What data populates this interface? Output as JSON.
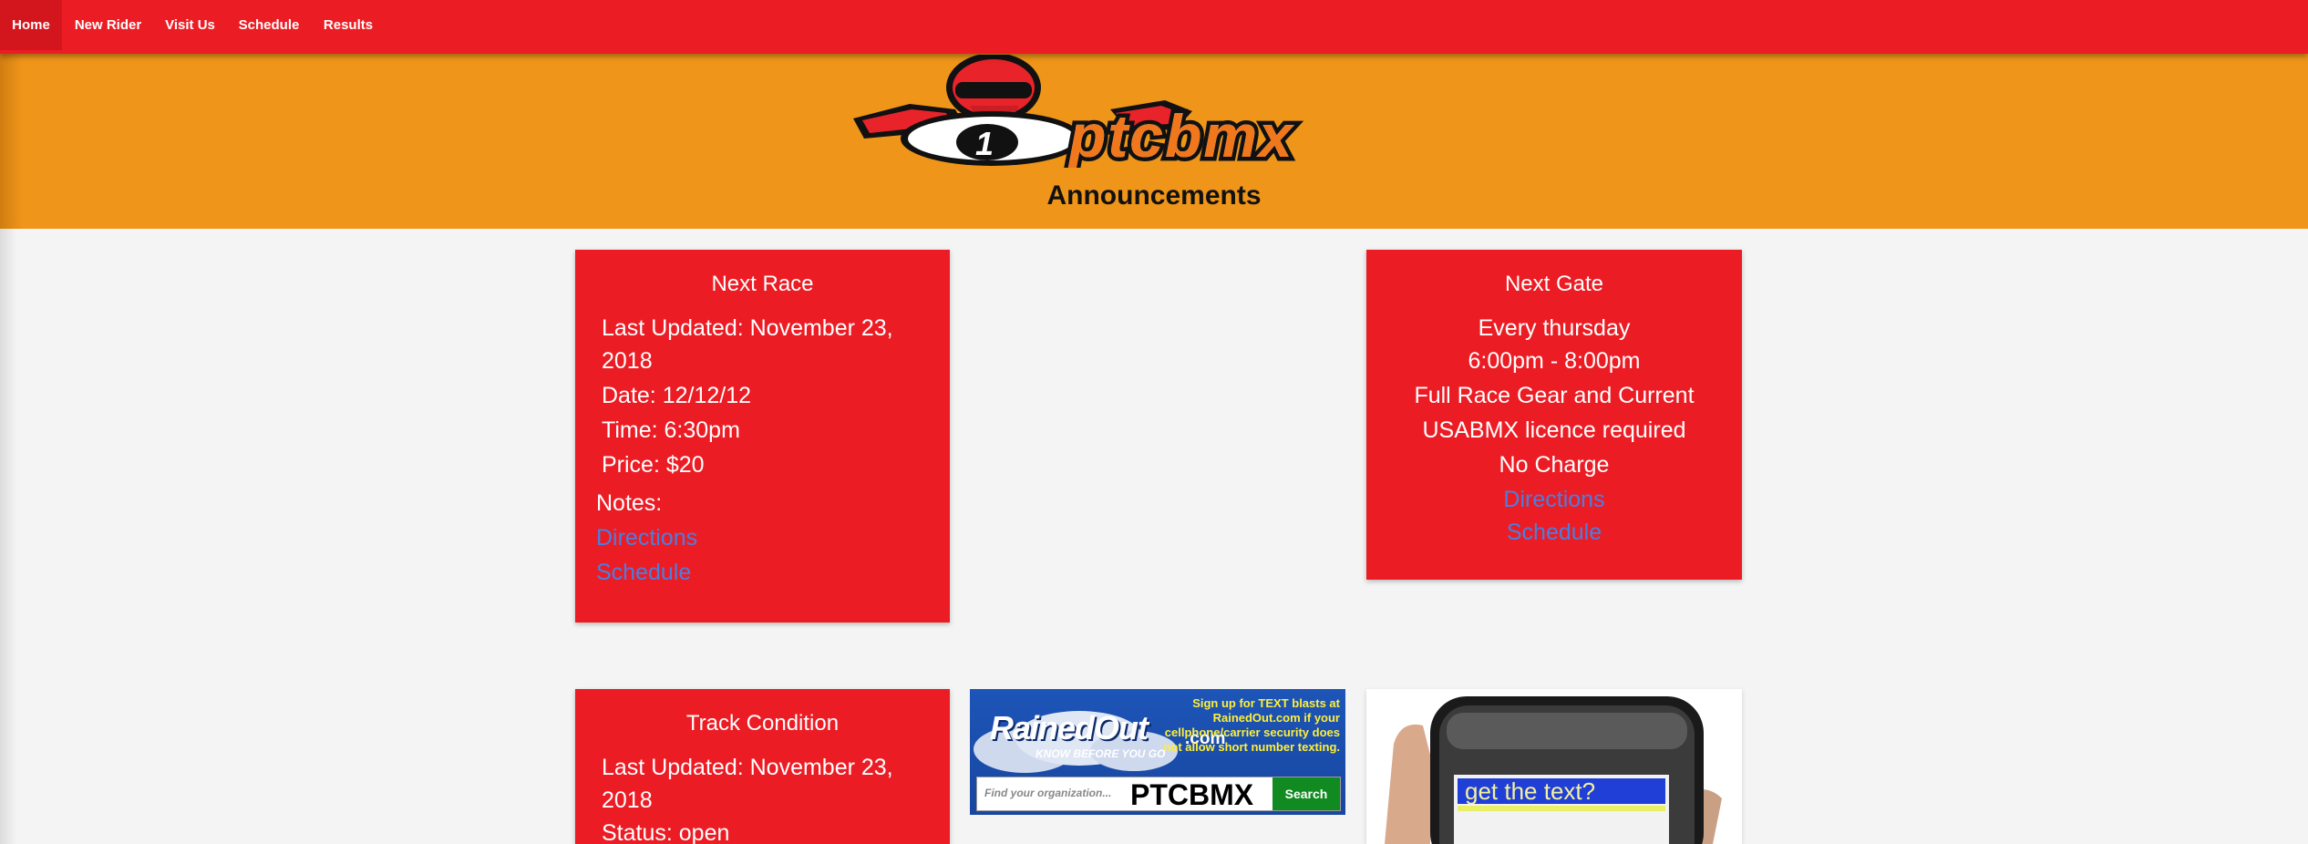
{
  "nav": {
    "items": [
      {
        "label": "Home",
        "active": true
      },
      {
        "label": "New Rider"
      },
      {
        "label": "Visit Us"
      },
      {
        "label": "Schedule"
      },
      {
        "label": "Results"
      }
    ]
  },
  "header": {
    "logo_text": "ptcbmx",
    "logo_plate": "1",
    "heading": "Announcements"
  },
  "next_race": {
    "title": "Next Race",
    "updated_line1": "Last Updated: November 23,",
    "updated_line2": "2018",
    "date": "Date: 12/12/12",
    "time": "Time: 6:30pm",
    "price": "Price: $20",
    "notes": "Notes:",
    "directions_link": "Directions",
    "schedule_link": "Schedule"
  },
  "next_gate": {
    "title": "Next Gate",
    "line1": "Every thursday",
    "line2": "6:00pm - 8:00pm",
    "line3": "Full Race Gear and Current",
    "line4": "USABMX licence required",
    "line5": "No Charge",
    "directions_link": "Directions",
    "schedule_link": "Schedule"
  },
  "track_condition": {
    "title": "Track Condition",
    "updated_line1": "Last Updated: November 23,",
    "updated_line2": "2018",
    "status": "Status: open"
  },
  "rainedout_ad": {
    "brand": "RainedOut",
    "tagline": "KNOW BEFORE YOU GO",
    "domain": ".com",
    "blurb": "Sign up for TEXT blasts at RainedOut.com if your cellphone/carrier security does not allow short number texting.",
    "search_placeholder": "Find your organization...",
    "search_value": "PTCBMX",
    "search_button": "Search"
  },
  "phone_ad": {
    "screen_text": "get the text?"
  },
  "colors": {
    "nav_red": "#ec1c24",
    "banner_orange": "#ef9519",
    "card_red": "#ec1c24",
    "link_blue": "#4a7fe0",
    "page_bg": "#f4f4f4"
  }
}
